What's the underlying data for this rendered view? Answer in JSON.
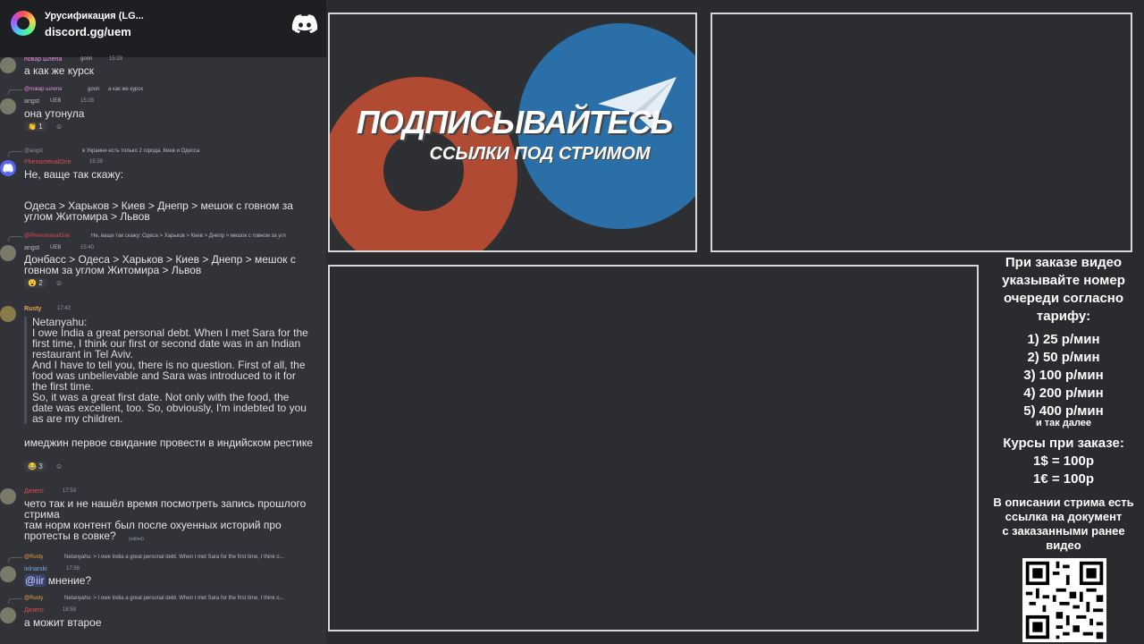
{
  "server": {
    "name": "Урусификация (LG...",
    "invite": "discord.gg/uem"
  },
  "messages": [
    {
      "user": "повар шлепа",
      "tag": "goon",
      "time": "15:28",
      "text": "а как же курск"
    },
    {
      "reply_user": "@повар шлепа",
      "reply_tag": "goon",
      "reply_text": "а как же курск",
      "user": "angst",
      "tag": "UEB",
      "time": "15:28",
      "text": "она утонула",
      "reaction": "1"
    },
    {
      "reply_user": "@angst",
      "reply_tag": "UEB",
      "reply_text": "в Украине есть только 2 города, Киев и Одесса",
      "user": "PhenomenalOne",
      "time": "15:39",
      "text1": "Не, ваще так скажу:",
      "text2": "Одеса > Харьков > Киев > Днепр > мешок с говном за углом Житомира > Львов"
    },
    {
      "reply_user": "@PhenomenalOne",
      "reply_text": "Не, ваще так скажу:   Одеса > Харьков > Киев > Днепр > мешок с говном за угл",
      "user": "angst",
      "tag": "UEB",
      "time": "15:40",
      "text": "Донбасс > Одеса > Харьков > Киев > Днепр > мешок с говном за углом Житомира > Львов",
      "reaction": "2"
    },
    {
      "user": "Rusty",
      "time": "17:42",
      "quote": "Netanyahu:\nI owe India a great personal debt. When I met Sara for the first time, I think our first or second date was in an Indian restaurant in Tel Aviv.\nAnd I have to tell you, there is no question. First of all, the food was unbelievable and Sara was introduced to it for the first time.\nSo, it was a great first date. Not only with the food, the date was excellent, too. So, obviously, I'm indebted to you as are my children.",
      "text": "имеджин первое свидание провести в индийском рестике",
      "reaction": "3"
    },
    {
      "user": "Дезеro",
      "time": "17:53",
      "text": "чето так и не нашёл время посмотреть запись прошлого стрима\nтам норм контент был после охуенных историй про протесты в совке?",
      "edited": "(edited)"
    },
    {
      "reply_user": "@Rusty",
      "reply_text": "Netanyahu: > I owe India a great personal debt. When I met Sara for the first time, I think o...",
      "user": "inlnarski",
      "time": "17:56",
      "mention": "@iir",
      "text": " мнение?"
    },
    {
      "reply_user": "@Rusty",
      "reply_text": "Netanyahu: > I owe India a great personal debt. When I met Sara for the first time, I think o...",
      "user": "Дезеro",
      "time": "18:59",
      "text": "а можит втарое"
    }
  ],
  "promo": {
    "title": "ПОДПИСЫВАЙТЕСЬ",
    "subtitle": "ССЫЛКИ ПОД СТРИМОМ"
  },
  "info": {
    "intro": [
      "При заказе видео",
      "указывайте номер",
      "очереди согласно",
      "тарифу:"
    ],
    "tariffs": [
      "1) 25 р/мин",
      "2) 50 р/мин",
      "3) 100 р/мин",
      "4) 200 р/мин",
      "5) 400 р/мин"
    ],
    "etc": "и так далее",
    "rates_title": "Курсы при заказе:",
    "rates": [
      "1$ = 100р",
      "1€ = 100р"
    ],
    "desc": [
      "В описании стрима есть",
      "ссылка на документ",
      "с заказанными ранее",
      "видео"
    ]
  },
  "colors": {
    "discord_blurple": "#5865f2",
    "username_pink": "#e78ee0",
    "username_orange": "#e8a24a",
    "username_red": "#e04a4a",
    "username_blue": "#7aa9e8",
    "mention_bg": "#3c4270"
  }
}
